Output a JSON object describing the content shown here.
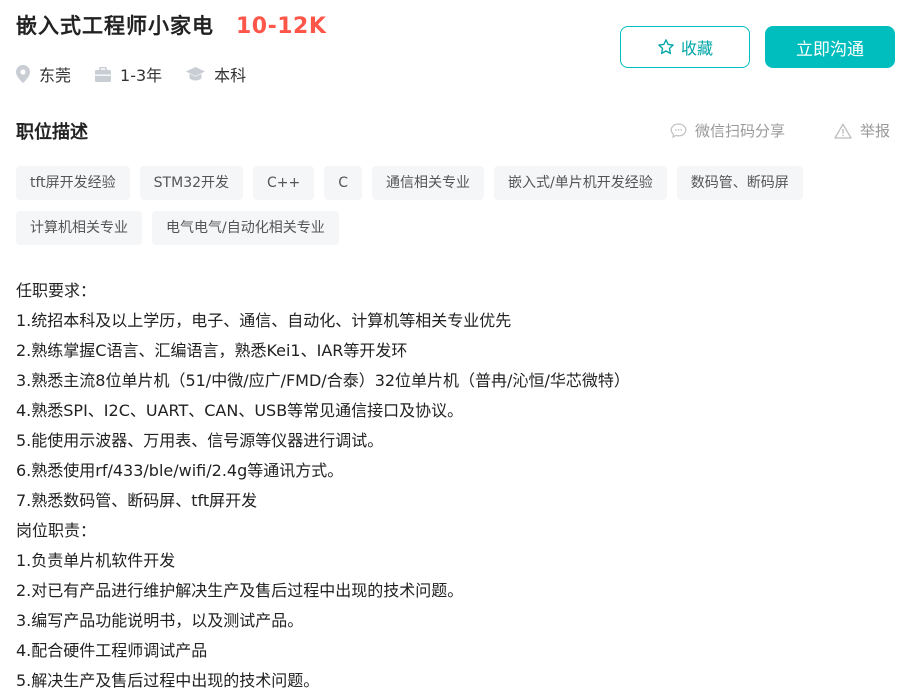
{
  "job": {
    "title": "嵌入式工程师小家电",
    "salary": "10-12K",
    "location": "东莞",
    "experience": "1-3年",
    "education": "本科"
  },
  "actions": {
    "favorite_label": "收藏",
    "chat_label": "立即沟通"
  },
  "section": {
    "title": "职位描述",
    "share_label": "微信扫码分享",
    "report_label": "举报"
  },
  "tags": [
    "tft屏开发经验",
    "STM32开发",
    "C++",
    "C",
    "通信相关专业",
    "嵌入式/单片机开发经验",
    "数码管、断码屏",
    "计算机相关专业",
    "电气电气/自动化相关专业"
  ],
  "description": [
    "任职要求：",
    "1.统招本科及以上学历，电子、通信、自动化、计算机等相关专业优先",
    "2.熟练掌握C语言、汇编语言，熟悉Kei1、IAR等开发环",
    "3.熟悉主流8位单片机（51/中微/应广/FMD/合泰）32位单片机（普冉/沁恒/华芯微特）",
    "4.熟悉SPI、I2C、UART、CAN、USB等常见通信接口及协议。",
    "5.能使用示波器、万用表、信号源等仪器进行调试。",
    "6.熟悉使用rf/433/ble/wifi/2.4g等通讯方式。",
    "7.熟悉数码管、断码屏、tft屏开发",
    "岗位职责：",
    "1.负责单片机软件开发",
    "2.对已有产品进行维护解决生产及售后过程中出现的技术问题。",
    "3.编写产品功能说明书，以及测试产品。",
    "4.配合硬件工程师调试产品",
    "5.解决生产及售后过程中出现的技术问题。"
  ],
  "colors": {
    "accent": "#00bebd",
    "salary": "#fe574a",
    "tag_bg": "#f5f6f8",
    "muted": "#999999"
  },
  "icons": {
    "location": "location-pin-icon",
    "experience": "briefcase-icon",
    "education": "graduation-cap-icon",
    "favorite": "star-icon",
    "share": "wechat-icon",
    "report": "warning-icon"
  }
}
